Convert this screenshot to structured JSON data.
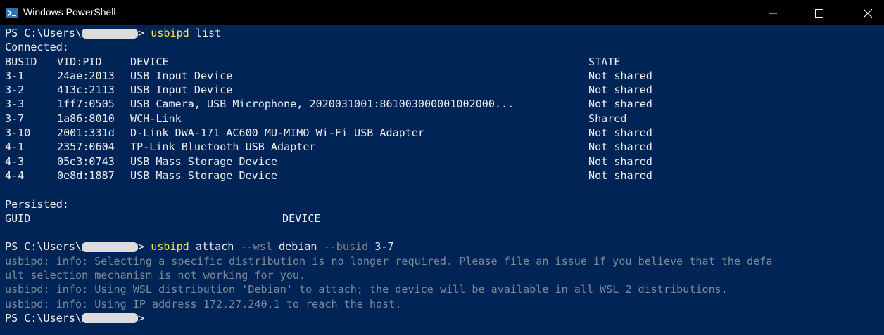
{
  "window": {
    "title": "Windows PowerShell"
  },
  "prompt": {
    "prefix": "PS C:\\Users\\",
    "suffix": ">"
  },
  "commands": {
    "list": {
      "exe": "usbipd",
      "args": " list"
    },
    "attach": {
      "exe": "usbipd",
      "a1": " attach ",
      "p1": "--wsl",
      "a2": " debian ",
      "p2": "--busid",
      "a3": " 3-7"
    }
  },
  "connected": {
    "heading": "Connected:",
    "headers": {
      "busid": "BUSID",
      "vidpid": "VID:PID",
      "device": "DEVICE",
      "state": "STATE"
    },
    "rows": [
      {
        "busid": "3-1",
        "vidpid": "24ae:2013",
        "device": "USB Input Device",
        "state": "Not shared"
      },
      {
        "busid": "3-2",
        "vidpid": "413c:2113",
        "device": "USB Input Device",
        "state": "Not shared"
      },
      {
        "busid": "3-3",
        "vidpid": "1ff7:0505",
        "device": "USB Camera, USB Microphone, 2020031001:861003000001002000...",
        "state": "Not shared"
      },
      {
        "busid": "3-7",
        "vidpid": "1a86:8010",
        "device": "WCH-Link",
        "state": "Shared"
      },
      {
        "busid": "3-10",
        "vidpid": "2001:331d",
        "device": "D-Link DWA-171 AC600 MU-MIMO Wi-Fi USB Adapter",
        "state": "Not shared"
      },
      {
        "busid": "4-1",
        "vidpid": "2357:0604",
        "device": "TP-Link Bluetooth USB Adapter",
        "state": "Not shared"
      },
      {
        "busid": "4-3",
        "vidpid": "05e3:0743",
        "device": "USB Mass Storage Device",
        "state": "Not shared"
      },
      {
        "busid": "4-4",
        "vidpid": "0e8d:1887",
        "device": "USB Mass Storage Device",
        "state": "Not shared"
      }
    ]
  },
  "persisted": {
    "heading": "Persisted:",
    "headers": {
      "guid": "GUID",
      "device": "DEVICE"
    }
  },
  "info_lines": [
    "usbipd: info: Selecting a specific distribution is no longer required. Please file an issue if you believe that the defa",
    "ult selection mechanism is not working for you.",
    "usbipd: info: Using WSL distribution 'Debian' to attach; the device will be available in all WSL 2 distributions.",
    "usbipd: info: Using IP address 172.27.240.1 to reach the host."
  ],
  "colors": {
    "background": "#012456",
    "text": "#eeedf0",
    "command": "#f5e64e",
    "info": "#7f8a98"
  }
}
